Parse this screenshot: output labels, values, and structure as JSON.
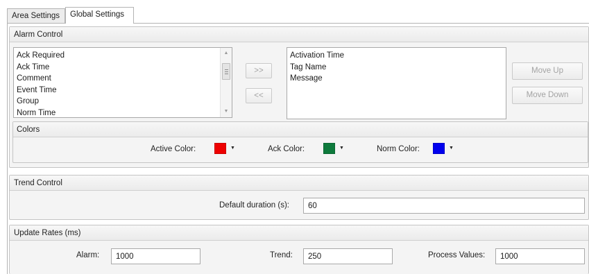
{
  "tabs": [
    {
      "label": "Area Settings"
    },
    {
      "label": "Global Settings"
    }
  ],
  "alarm_control": {
    "title": "Alarm Control",
    "available_columns": [
      "Ack Required",
      "Ack Time",
      "Comment",
      "Event Time",
      "Group",
      "Norm Time"
    ],
    "selected_columns": [
      "Activation Time",
      "Tag Name",
      "Message"
    ],
    "add_label": ">>",
    "remove_label": "<<",
    "move_up_label": "Move Up",
    "move_down_label": "Move Down",
    "colors": {
      "title": "Colors",
      "active_label": "Active Color:",
      "active_color": "#ee0000",
      "ack_label": "Ack Color:",
      "ack_color": "#0e7a3c",
      "norm_label": "Norm Color:",
      "norm_color": "#0000ee"
    }
  },
  "trend_control": {
    "title": "Trend Control",
    "duration_label": "Default duration (s):",
    "duration_value": "60"
  },
  "update_rates": {
    "title": "Update Rates (ms)",
    "alarm_label": "Alarm:",
    "alarm_value": "1000",
    "trend_label": "Trend:",
    "trend_value": "250",
    "process_label": "Process Values:",
    "process_value": "1000"
  },
  "icons": {
    "dropdown_caret": "▼",
    "scroll_up": "▲",
    "scroll_down": "▼"
  }
}
